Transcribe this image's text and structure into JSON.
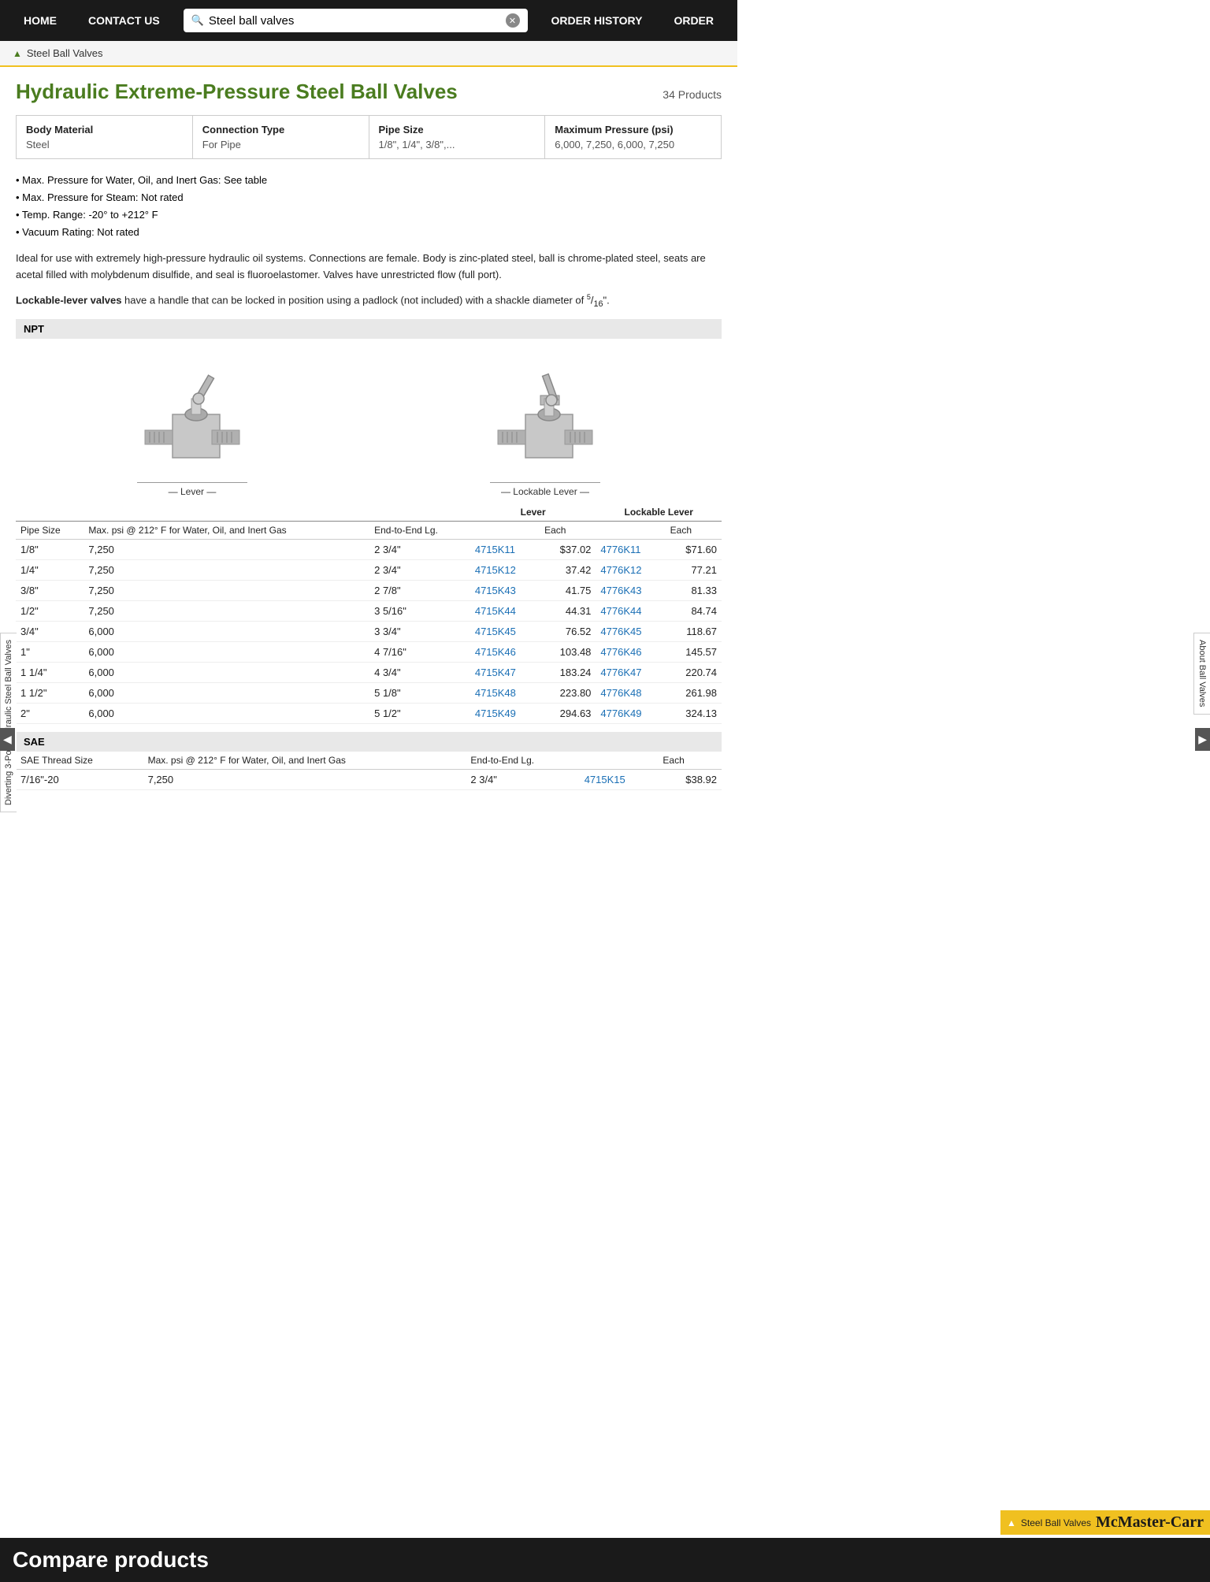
{
  "nav": {
    "home": "HOME",
    "contact": "CONTACT US",
    "order_history": "ORDER HISTORY",
    "order": "ORDER",
    "search_value": "Steel ball valves"
  },
  "breadcrumb": {
    "arrow": "▲",
    "text": "Steel Ball Valves"
  },
  "page": {
    "title": "Hydraulic Extreme-Pressure Steel Ball Valves",
    "product_count": "34 Products"
  },
  "filters": [
    {
      "label": "Body Material",
      "value": "Steel"
    },
    {
      "label": "Connection Type",
      "value": "For Pipe"
    },
    {
      "label": "Pipe Size",
      "value": "1/8\", 1/4\", 3/8\",..."
    },
    {
      "label": "Maximum Pressure (psi)",
      "value": "6,000, 7,250, 6,000, 7,250"
    }
  ],
  "bullets": [
    "• Max. Pressure for Water, Oil, and Inert Gas: See table",
    "• Max. Pressure for Steam: Not rated",
    "• Temp. Range: -20° to +212° F",
    "• Vacuum Rating: Not rated"
  ],
  "description": "Ideal for use with extremely high-pressure hydraulic oil systems. Connections are female. Body is zinc-plated steel, ball is chrome-plated steel, seats are acetal filled with molybdenum disulfide, and seal is fluoroelastomer. Valves have unrestricted flow (full port).",
  "lockable_note": "Lockable-lever valves have a handle that can be locked in position using a padlock (not included) with a shackle diameter of 5/16\".",
  "section_npt": "NPT",
  "table_headers": {
    "pipe_size": "Pipe Size",
    "max_psi": "Max. psi @ 212° F for Water, Oil, and Inert Gas",
    "end_to_end": "End-to-End Lg.",
    "lever_label": "Lever",
    "lockable_label": "Lockable Lever",
    "each": "Each"
  },
  "npt_rows": [
    {
      "pipe": "1/8\"",
      "psi": "7,250",
      "end": "2 3/4\"",
      "lever_pn": "4715K11",
      "lever_price": "$37.02",
      "lock_pn": "4776K11",
      "lock_price": "$71.60"
    },
    {
      "pipe": "1/4\"",
      "psi": "7,250",
      "end": "2 3/4\"",
      "lever_pn": "4715K12",
      "lever_price": "37.42",
      "lock_pn": "4776K12",
      "lock_price": "77.21"
    },
    {
      "pipe": "3/8\"",
      "psi": "7,250",
      "end": "2 7/8\"",
      "lever_pn": "4715K43",
      "lever_price": "41.75",
      "lock_pn": "4776K43",
      "lock_price": "81.33"
    },
    {
      "pipe": "1/2\"",
      "psi": "7,250",
      "end": "3 5/16\"",
      "lever_pn": "4715K44",
      "lever_price": "44.31",
      "lock_pn": "4776K44",
      "lock_price": "84.74"
    },
    {
      "pipe": "3/4\"",
      "psi": "6,000",
      "end": "3 3/4\"",
      "lever_pn": "4715K45",
      "lever_price": "76.52",
      "lock_pn": "4776K45",
      "lock_price": "118.67"
    },
    {
      "pipe": "1\"",
      "psi": "6,000",
      "end": "4 7/16\"",
      "lever_pn": "4715K46",
      "lever_price": "103.48",
      "lock_pn": "4776K46",
      "lock_price": "145.57"
    },
    {
      "pipe": "1 1/4\"",
      "psi": "6,000",
      "end": "4 3/4\"",
      "lever_pn": "4715K47",
      "lever_price": "183.24",
      "lock_pn": "4776K47",
      "lock_price": "220.74"
    },
    {
      "pipe": "1 1/2\"",
      "psi": "6,000",
      "end": "5 1/8\"",
      "lever_pn": "4715K48",
      "lever_price": "223.80",
      "lock_pn": "4776K48",
      "lock_price": "261.98"
    },
    {
      "pipe": "2\"",
      "psi": "6,000",
      "end": "5 1/2\"",
      "lever_pn": "4715K49",
      "lever_price": "294.63",
      "lock_pn": "4776K49",
      "lock_price": "324.13"
    }
  ],
  "brand_badge": {
    "arrow": "▲",
    "label": "Steel Ball Valves",
    "brand": "McMaster-Carr"
  },
  "section_sae": "SAE",
  "sae_headers": {
    "thread_size": "SAE Thread Size",
    "max_psi": "Max. psi @ 212° F for Water, Oil, and Inert Gas",
    "end_to_end": "End-to-End Lg.",
    "each": "Each"
  },
  "sae_first_row": {
    "thread": "7/16\"-20",
    "psi": "7,250",
    "end": "2 3/4\"",
    "pn": "4715K15",
    "price": "$38.92"
  },
  "footer": {
    "compare": "Compare products"
  },
  "side_left": "Diverting 3-Port Hydraulic Steel Ball Valves",
  "side_right": "About Ball Valves"
}
